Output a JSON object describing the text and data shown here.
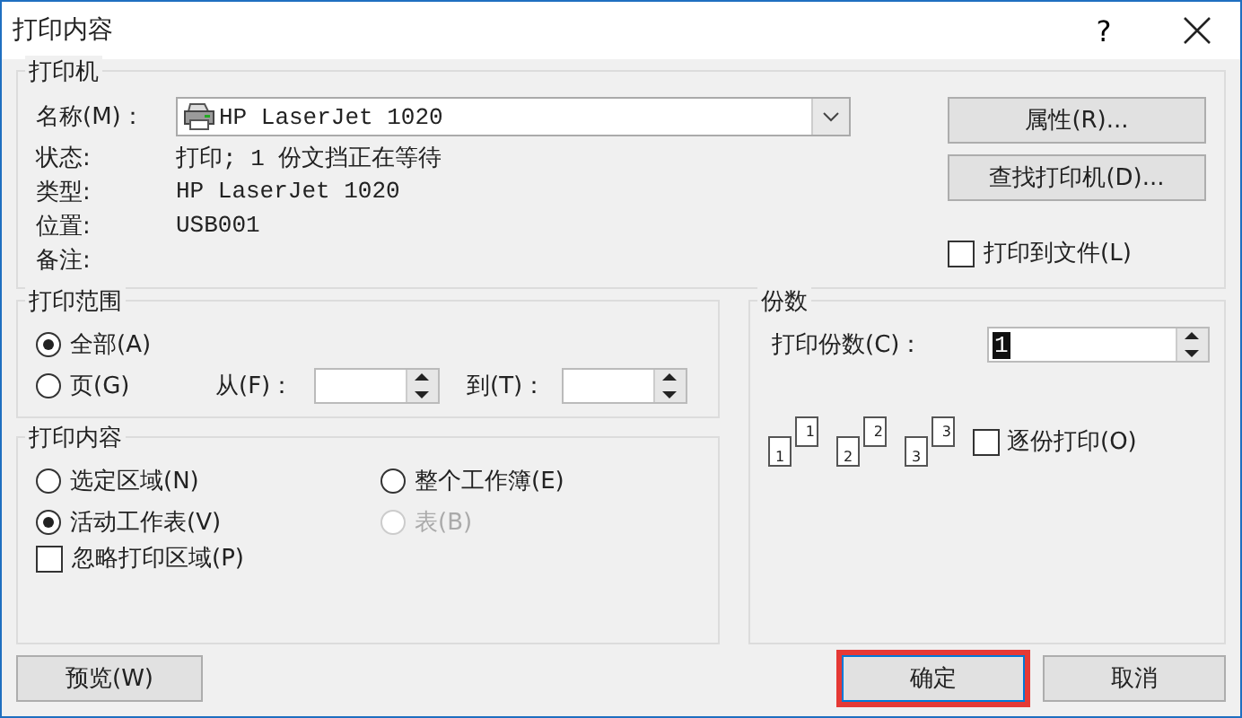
{
  "window": {
    "title": "打印内容",
    "help": "?"
  },
  "printer": {
    "legend": "打印机",
    "name_label": "名称(M)：",
    "name_value": "HP LaserJet 1020",
    "info": [
      {
        "label": "状态:",
        "value": "打印; 1 份文挡正在等待"
      },
      {
        "label": "类型:",
        "value": "HP LaserJet 1020"
      },
      {
        "label": "位置:",
        "value": "USB001"
      },
      {
        "label": "备注:"
      }
    ],
    "buttons": [
      "属性(R)...",
      "查找打印机(D)..."
    ],
    "print_to_file": {
      "label": "打印到文件(L)",
      "checked": false
    }
  },
  "range": {
    "legend": "打印范围",
    "options": [
      {
        "label": "全部(A)",
        "selected": true
      },
      {
        "label": "页(G)",
        "selected": false
      }
    ],
    "from_label": "从(F)：",
    "to_label": "到(T)："
  },
  "content": {
    "legend": "打印内容",
    "options": [
      {
        "label": "选定区域(N)",
        "selected": false,
        "disabled": false
      },
      {
        "label": "整个工作簿(E)",
        "selected": false,
        "disabled": false
      },
      {
        "label": "活动工作表(V)",
        "selected": true,
        "disabled": false
      },
      {
        "label": "表(B)",
        "selected": false,
        "disabled": true
      }
    ],
    "ignore_area": {
      "label": "忽略打印区域(P)",
      "checked": false
    }
  },
  "copies": {
    "legend": "份数",
    "count_label": "打印份数(C)：",
    "count_value": "1",
    "stacks": [
      {
        "back": "1",
        "front": "1"
      },
      {
        "back": "2",
        "front": "2"
      },
      {
        "back": "3",
        "front": "3"
      }
    ],
    "collate": {
      "label": "逐份打印(O)",
      "checked": false
    }
  },
  "buttons": [
    {
      "label": "预览(W)",
      "kind": "normal",
      "highlighted": false
    },
    {
      "label": "确定",
      "kind": "default",
      "highlighted": true
    },
    {
      "label": "取消",
      "kind": "normal",
      "highlighted": false
    }
  ]
}
